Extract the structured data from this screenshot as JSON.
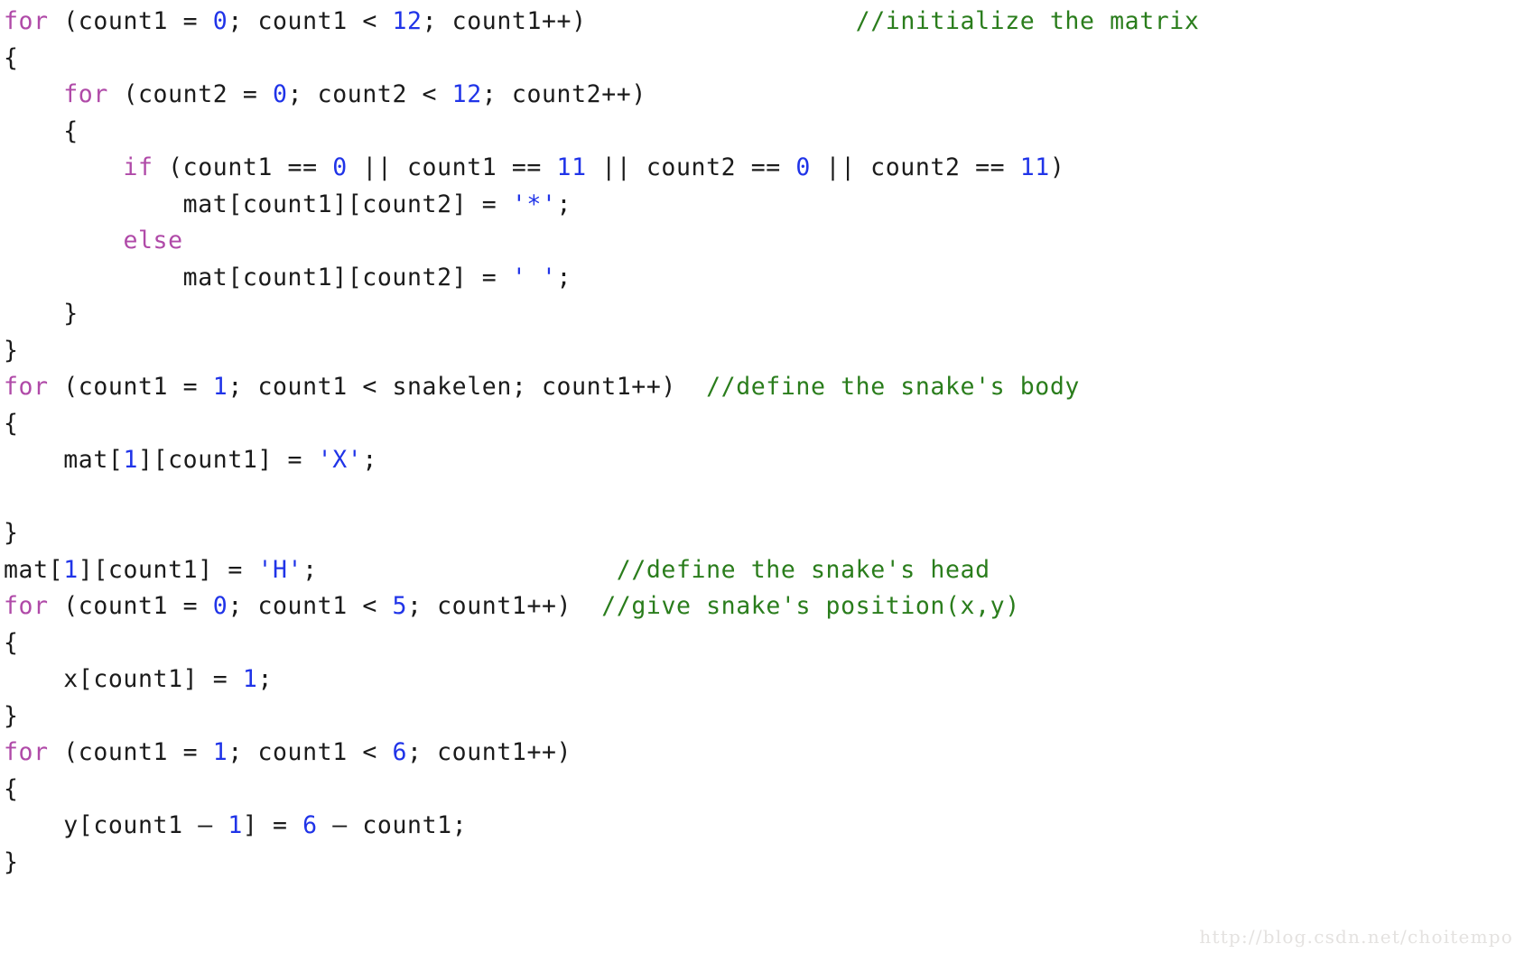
{
  "document": {
    "kind": "code-snippet-screenshot",
    "language": "c",
    "background_color": "#ffffff"
  },
  "theme": {
    "keyword_color": "#b04aa8",
    "number_color": "#2034e8",
    "string_color": "#2034e8",
    "comment_color": "#2a7d1c",
    "plain_color": "#1b1b1b",
    "watermark_color": "#e4e2e0"
  },
  "watermark": {
    "text": "http://blog.csdn.net/choitempo"
  },
  "code": {
    "lines": [
      {
        "index": 1,
        "text": "for (count1 = 0; count1 < 12; count1++)                  //initialize the matrix",
        "tokens": [
          {
            "t": "for",
            "c": "kw"
          },
          {
            "t": " (count1 = ",
            "c": "plain"
          },
          {
            "t": "0",
            "c": "num"
          },
          {
            "t": "; count1 < ",
            "c": "plain"
          },
          {
            "t": "12",
            "c": "num"
          },
          {
            "t": "; count1++)",
            "c": "plain"
          },
          {
            "t": "                  ",
            "c": "plain"
          },
          {
            "t": "//initialize the matrix",
            "c": "comment"
          }
        ]
      },
      {
        "index": 2,
        "text": "{",
        "tokens": [
          {
            "t": "{",
            "c": "plain"
          }
        ]
      },
      {
        "index": 3,
        "text": "    for (count2 = 0; count2 < 12; count2++)",
        "tokens": [
          {
            "t": "    ",
            "c": "plain"
          },
          {
            "t": "for",
            "c": "kw"
          },
          {
            "t": " (count2 = ",
            "c": "plain"
          },
          {
            "t": "0",
            "c": "num"
          },
          {
            "t": "; count2 < ",
            "c": "plain"
          },
          {
            "t": "12",
            "c": "num"
          },
          {
            "t": "; count2++)",
            "c": "plain"
          }
        ]
      },
      {
        "index": 4,
        "text": "    {",
        "tokens": [
          {
            "t": "    {",
            "c": "plain"
          }
        ]
      },
      {
        "index": 5,
        "text": "        if (count1 == 0 || count1 == 11 || count2 == 0 || count2 == 11)",
        "tokens": [
          {
            "t": "        ",
            "c": "plain"
          },
          {
            "t": "if",
            "c": "kw"
          },
          {
            "t": " (count1 == ",
            "c": "plain"
          },
          {
            "t": "0",
            "c": "num"
          },
          {
            "t": " || count1 == ",
            "c": "plain"
          },
          {
            "t": "11",
            "c": "num"
          },
          {
            "t": " || count2 == ",
            "c": "plain"
          },
          {
            "t": "0",
            "c": "num"
          },
          {
            "t": " || count2 == ",
            "c": "plain"
          },
          {
            "t": "11",
            "c": "num"
          },
          {
            "t": ")",
            "c": "plain"
          }
        ]
      },
      {
        "index": 6,
        "text": "            mat[count1][count2] = '*';",
        "tokens": [
          {
            "t": "            mat[count1][count2] = ",
            "c": "plain"
          },
          {
            "t": "'*'",
            "c": "str"
          },
          {
            "t": ";",
            "c": "plain"
          }
        ]
      },
      {
        "index": 7,
        "text": "        else",
        "tokens": [
          {
            "t": "        ",
            "c": "plain"
          },
          {
            "t": "else",
            "c": "kw"
          }
        ]
      },
      {
        "index": 8,
        "text": "            mat[count1][count2] = ' ';",
        "tokens": [
          {
            "t": "            mat[count1][count2] = ",
            "c": "plain"
          },
          {
            "t": "' '",
            "c": "str"
          },
          {
            "t": ";",
            "c": "plain"
          }
        ]
      },
      {
        "index": 9,
        "text": "    }",
        "tokens": [
          {
            "t": "    }",
            "c": "plain"
          }
        ]
      },
      {
        "index": 10,
        "text": "}",
        "tokens": [
          {
            "t": "}",
            "c": "plain"
          }
        ]
      },
      {
        "index": 11,
        "text": "for (count1 = 1; count1 < snakelen; count1++)  //define the snake's body",
        "tokens": [
          {
            "t": "for",
            "c": "kw"
          },
          {
            "t": " (count1 = ",
            "c": "plain"
          },
          {
            "t": "1",
            "c": "num"
          },
          {
            "t": "; count1 < snakelen; count1++)",
            "c": "plain"
          },
          {
            "t": "  ",
            "c": "plain"
          },
          {
            "t": "//define the snake's body",
            "c": "comment"
          }
        ]
      },
      {
        "index": 12,
        "text": "{",
        "tokens": [
          {
            "t": "{",
            "c": "plain"
          }
        ]
      },
      {
        "index": 13,
        "text": "    mat[1][count1] = 'X';",
        "tokens": [
          {
            "t": "    mat[",
            "c": "plain"
          },
          {
            "t": "1",
            "c": "num"
          },
          {
            "t": "][count1] = ",
            "c": "plain"
          },
          {
            "t": "'X'",
            "c": "str"
          },
          {
            "t": ";",
            "c": "plain"
          }
        ]
      },
      {
        "index": 14,
        "text": "",
        "tokens": []
      },
      {
        "index": 15,
        "text": "}",
        "tokens": [
          {
            "t": "}",
            "c": "plain"
          }
        ]
      },
      {
        "index": 16,
        "text": "mat[1][count1] = 'H';                    //define the snake's head",
        "tokens": [
          {
            "t": "mat[",
            "c": "plain"
          },
          {
            "t": "1",
            "c": "num"
          },
          {
            "t": "][count1] = ",
            "c": "plain"
          },
          {
            "t": "'H'",
            "c": "str"
          },
          {
            "t": ";",
            "c": "plain"
          },
          {
            "t": "                    ",
            "c": "plain"
          },
          {
            "t": "//define the snake's head",
            "c": "comment"
          }
        ]
      },
      {
        "index": 17,
        "text": "for (count1 = 0; count1 < 5; count1++)  //give snake's position(x,y)",
        "tokens": [
          {
            "t": "for",
            "c": "kw"
          },
          {
            "t": " (count1 = ",
            "c": "plain"
          },
          {
            "t": "0",
            "c": "num"
          },
          {
            "t": "; count1 < ",
            "c": "plain"
          },
          {
            "t": "5",
            "c": "num"
          },
          {
            "t": "; count1++)",
            "c": "plain"
          },
          {
            "t": "  ",
            "c": "plain"
          },
          {
            "t": "//give snake's position(x,y)",
            "c": "comment"
          }
        ]
      },
      {
        "index": 18,
        "text": "{",
        "tokens": [
          {
            "t": "{",
            "c": "plain"
          }
        ]
      },
      {
        "index": 19,
        "text": "    x[count1] = 1;",
        "tokens": [
          {
            "t": "    x[count1] = ",
            "c": "plain"
          },
          {
            "t": "1",
            "c": "num"
          },
          {
            "t": ";",
            "c": "plain"
          }
        ]
      },
      {
        "index": 20,
        "text": "}",
        "tokens": [
          {
            "t": "}",
            "c": "plain"
          }
        ]
      },
      {
        "index": 21,
        "text": "for (count1 = 1; count1 < 6; count1++)",
        "tokens": [
          {
            "t": "for",
            "c": "kw"
          },
          {
            "t": " (count1 = ",
            "c": "plain"
          },
          {
            "t": "1",
            "c": "num"
          },
          {
            "t": "; count1 < ",
            "c": "plain"
          },
          {
            "t": "6",
            "c": "num"
          },
          {
            "t": "; count1++)",
            "c": "plain"
          }
        ]
      },
      {
        "index": 22,
        "text": "{",
        "tokens": [
          {
            "t": "{",
            "c": "plain"
          }
        ]
      },
      {
        "index": 23,
        "text": "    y[count1 - 1] = 6 - count1;",
        "tokens": [
          {
            "t": "    y[count1 ",
            "c": "plain"
          },
          {
            "t": "–",
            "c": "plain"
          },
          {
            "t": " ",
            "c": "plain"
          },
          {
            "t": "1",
            "c": "num"
          },
          {
            "t": "] = ",
            "c": "plain"
          },
          {
            "t": "6",
            "c": "num"
          },
          {
            "t": " ",
            "c": "plain"
          },
          {
            "t": "–",
            "c": "plain"
          },
          {
            "t": " count1;",
            "c": "plain"
          }
        ]
      },
      {
        "index": 24,
        "text": "}",
        "tokens": [
          {
            "t": "}",
            "c": "plain"
          }
        ]
      }
    ]
  }
}
